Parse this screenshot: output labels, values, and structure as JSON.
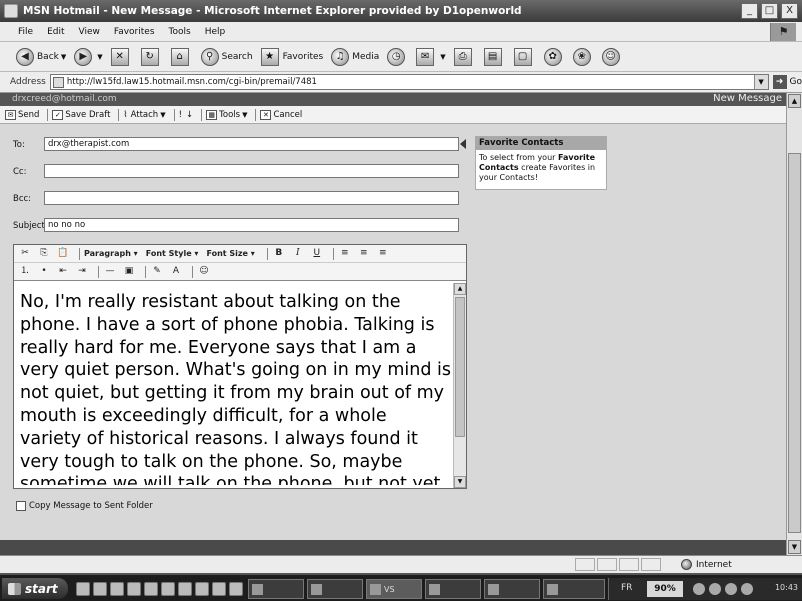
{
  "window": {
    "title": "MSN Hotmail - New Message - Microsoft Internet Explorer provided by D1openworld",
    "minimize": "_",
    "maximize": "□",
    "close": "X"
  },
  "menu": {
    "items": [
      "File",
      "Edit",
      "View",
      "Favorites",
      "Tools",
      "Help"
    ]
  },
  "toolbar": {
    "back": "Back",
    "search": "Search",
    "favorites": "Favorites",
    "media": "Media"
  },
  "address": {
    "label": "Address",
    "url": "http://lw15fd.law15.hotmail.msn.com/cgi-bin/premail/7481",
    "go": "Go"
  },
  "hotmail": {
    "account": "drxcreed@hotmail.com",
    "page_heading": "New Message"
  },
  "compose_toolbar": {
    "send": "Send",
    "save_draft": "Save Draft",
    "attach": "Attach",
    "tools": "Tools",
    "cancel": "Cancel"
  },
  "fields": {
    "to_label": "To:",
    "to_value": "drx@therapist.com",
    "cc_label": "Cc:",
    "cc_value": "",
    "bcc_label": "Bcc:",
    "bcc_value": "",
    "subject_label": "Subject:",
    "subject_value": "no no no"
  },
  "favorite_contacts": {
    "title": "Favorite Contacts",
    "text_1": "To select from your",
    "bold_1": "Favorite Contacts",
    "text_2": "create Favorites in your Contacts!"
  },
  "editor": {
    "paragraph": "Paragraph",
    "font_style": "Font Style",
    "font_size": "Font Size",
    "bold": "B",
    "italic": "I",
    "underline": "U",
    "body": "No, I'm really resistant about talking on the phone. I have a sort of phone phobia. Talking is really hard for me. Everyone says that I am a very quiet person. What's going on in my mind is not quiet, but getting it from my brain out of my mouth is exceedingly difficult, for a whole variety of historical reasons. I always found it very tough to talk on the phone. So, maybe sometime we will talk on the phone, but not yet. The thought"
  },
  "copy_checkbox": {
    "label": "Copy Message to Sent Folder"
  },
  "status": {
    "zone": "Internet"
  },
  "taskbar": {
    "start": "start",
    "tasks": [
      "",
      "",
      "",
      "",
      "VS",
      "",
      "",
      "",
      ""
    ],
    "lang": "FR",
    "zoom": "90%",
    "clock": "10:43"
  }
}
